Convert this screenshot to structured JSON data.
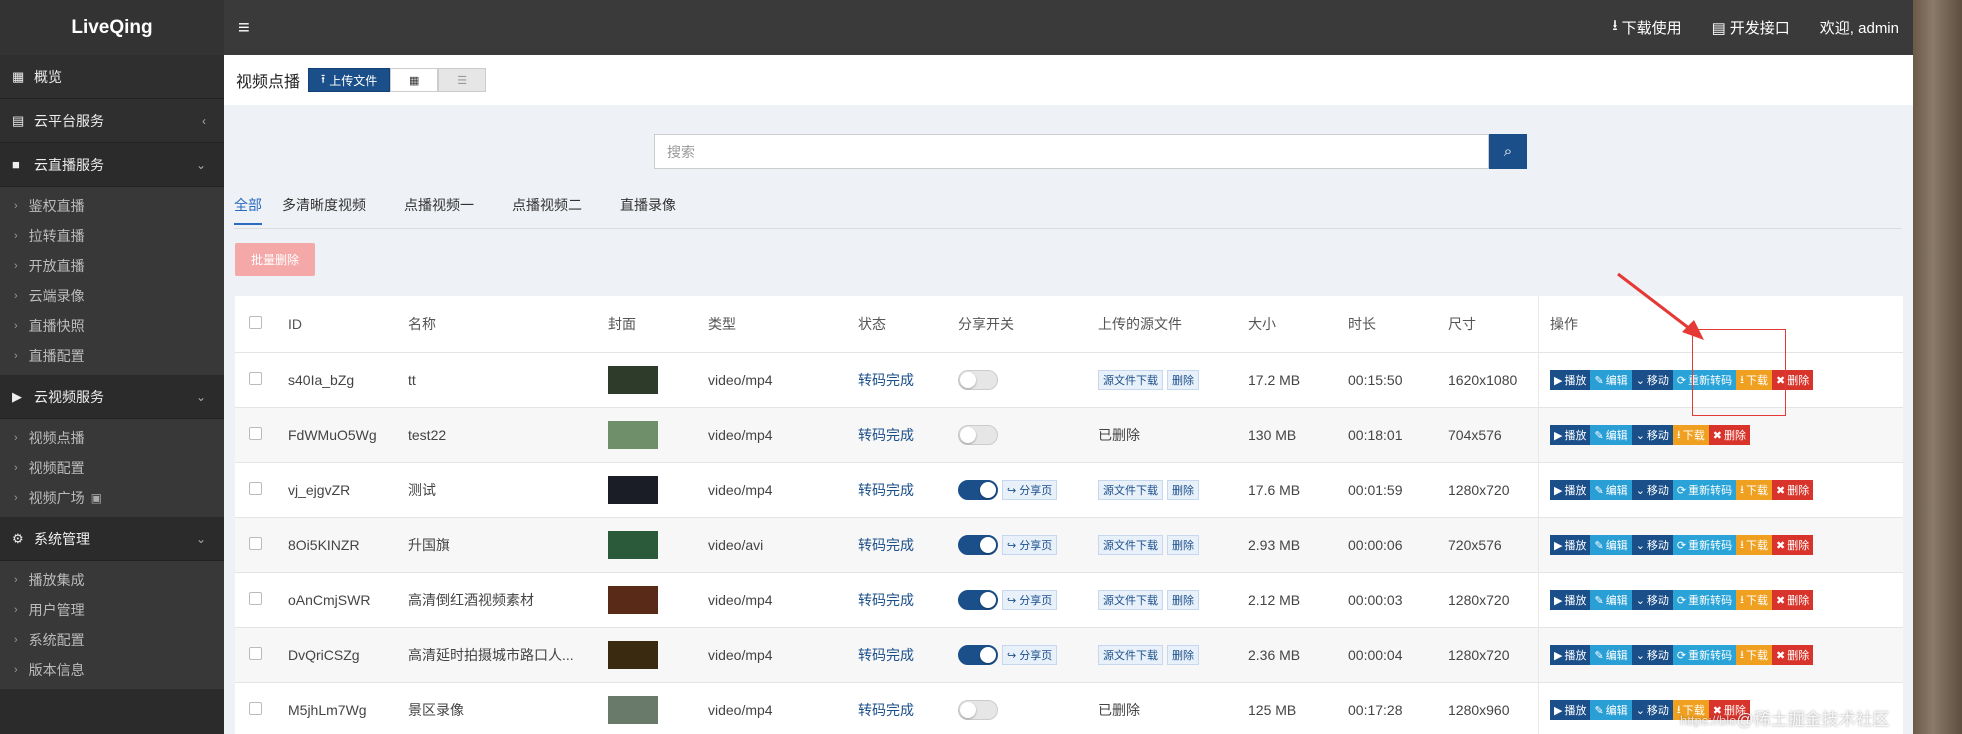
{
  "app": {
    "brand": "LiveQing",
    "menu_icon": "hamburger-icon"
  },
  "topbar": {
    "download": "下载使用",
    "api": "开发接口",
    "welcome": "欢迎, admin"
  },
  "sidebar": {
    "overview": "概览",
    "cloud_platform": "云平台服务",
    "cloud_live": "云直播服务",
    "live_items": [
      "鉴权直播",
      "拉转直播",
      "开放直播",
      "云端录像",
      "直播快照",
      "直播配置"
    ],
    "cloud_video": "云视频服务",
    "video_items": [
      "视频点播",
      "视频配置",
      "视频广场"
    ],
    "system": "系统管理",
    "system_items": [
      "播放集成",
      "用户管理",
      "系统配置",
      "版本信息"
    ]
  },
  "page": {
    "title": "视频点播",
    "upload_label": "上传文件",
    "search_placeholder": "搜索",
    "tabs": [
      "全部",
      "多清晰度视频",
      "点播视频一",
      "点播视频二",
      "直播录像"
    ],
    "active_tab": 0,
    "batch_delete": "批量删除"
  },
  "table": {
    "headers": [
      "ID",
      "名称",
      "封面",
      "类型",
      "状态",
      "分享开关",
      "上传的源文件",
      "大小",
      "时长",
      "尺寸",
      "操作"
    ],
    "rows": [
      {
        "id": "s40Ia_bZg",
        "name": "tt",
        "type": "video/mp4",
        "state": "转码完成",
        "share": false,
        "src": true,
        "size": "17.2 MB",
        "duration": "00:15:50",
        "dim": "1620x1080",
        "retrans": true,
        "thumb": "#2e3a2a"
      },
      {
        "id": "FdWMuO5Wg",
        "name": "test22",
        "type": "video/mp4",
        "state": "转码完成",
        "share": false,
        "src": false,
        "size": "130 MB",
        "duration": "00:18:01",
        "dim": "704x576",
        "retrans": false,
        "thumb": "#6f8f6a"
      },
      {
        "id": "vj_ejgvZR",
        "name": "测试",
        "type": "video/mp4",
        "state": "转码完成",
        "share": true,
        "src": true,
        "size": "17.6 MB",
        "duration": "00:01:59",
        "dim": "1280x720",
        "retrans": true,
        "thumb": "#1a1c26"
      },
      {
        "id": "8Oi5KINZR",
        "name": "升国旗",
        "type": "video/avi",
        "state": "转码完成",
        "share": true,
        "src": true,
        "size": "2.93 MB",
        "duration": "00:00:06",
        "dim": "720x576",
        "retrans": true,
        "thumb": "#2b5a3a"
      },
      {
        "id": "oAnCmjSWR",
        "name": "高清倒红酒视频素材",
        "type": "video/mp4",
        "state": "转码完成",
        "share": true,
        "src": true,
        "size": "2.12 MB",
        "duration": "00:00:03",
        "dim": "1280x720",
        "retrans": true,
        "thumb": "#5a2a18"
      },
      {
        "id": "DvQriCSZg",
        "name": "高清延时拍摄城市路口人...",
        "type": "video/mp4",
        "state": "转码完成",
        "share": true,
        "src": true,
        "size": "2.36 MB",
        "duration": "00:00:04",
        "dim": "1280x720",
        "retrans": true,
        "thumb": "#3a2a10"
      },
      {
        "id": "M5jhLm7Wg",
        "name": "景区录像",
        "type": "video/mp4",
        "state": "转码完成",
        "share": false,
        "src": false,
        "size": "125 MB",
        "duration": "00:17:28",
        "dim": "1280x960",
        "retrans": false,
        "thumb": "#6a7a6a"
      }
    ],
    "labels": {
      "src_download": "源文件下载",
      "src_delete": "删除",
      "src_deleted": "已删除",
      "share_page": "分享页",
      "op_play": "播放",
      "op_edit": "编辑",
      "op_move": "移动",
      "op_retrans": "重新转码",
      "op_download": "下载",
      "op_delete": "删除"
    }
  },
  "watermark": {
    "text": "@稀土掘金技术社区",
    "prefix": "https://blo"
  },
  "colors": {
    "primary": "#1b4f8a",
    "danger": "#d9342b",
    "warning": "#f0a020",
    "info": "#2aa4d8"
  }
}
